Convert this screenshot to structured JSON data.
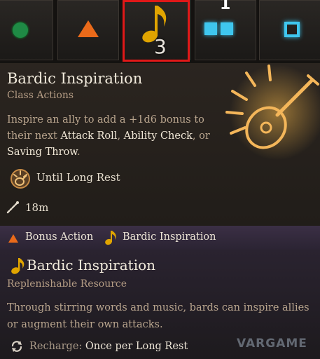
{
  "action_bar": {
    "slots": [
      {
        "icon": "green-circle-icon",
        "color": "#1f8a45"
      },
      {
        "icon": "orange-triangle-icon",
        "color": "#ea6a1a"
      },
      {
        "icon": "music-note-icon",
        "color": "#e0a400",
        "count": "3",
        "selected": true
      },
      {
        "icon": "double-square-icon",
        "color": "#3fc6ee",
        "number": "1"
      },
      {
        "icon": "square-ring-icon",
        "color": "#3fc6ee"
      }
    ]
  },
  "tooltip": {
    "title": "Bardic Inspiration",
    "subtitle": "Class Actions",
    "description": {
      "part1": "Inspire an ally to add a +1d6 bonus to their next ",
      "kw1": "Attack Roll",
      "sep1": ", ",
      "kw2": "Ability Check",
      "sep2": ", or ",
      "kw3": "Saving Throw",
      "end": "."
    },
    "duration": "Until Long Rest",
    "range": "18m"
  },
  "cost": {
    "action": "Bonus Action",
    "resource": "Bardic Inspiration"
  },
  "resource_panel": {
    "title": "Bardic Inspiration",
    "subtitle": "Replenishable Resource",
    "description": "Through stirring words and music, bards can inspire allies or augment their own attacks.",
    "recharge_label": "Recharge:",
    "recharge_value": "Once per Long Rest"
  },
  "watermark": "VARGAME",
  "colors": {
    "accent_gold": "#e0a400",
    "highlight_red": "#e01818",
    "bonus_action_orange": "#ea6a1a"
  }
}
